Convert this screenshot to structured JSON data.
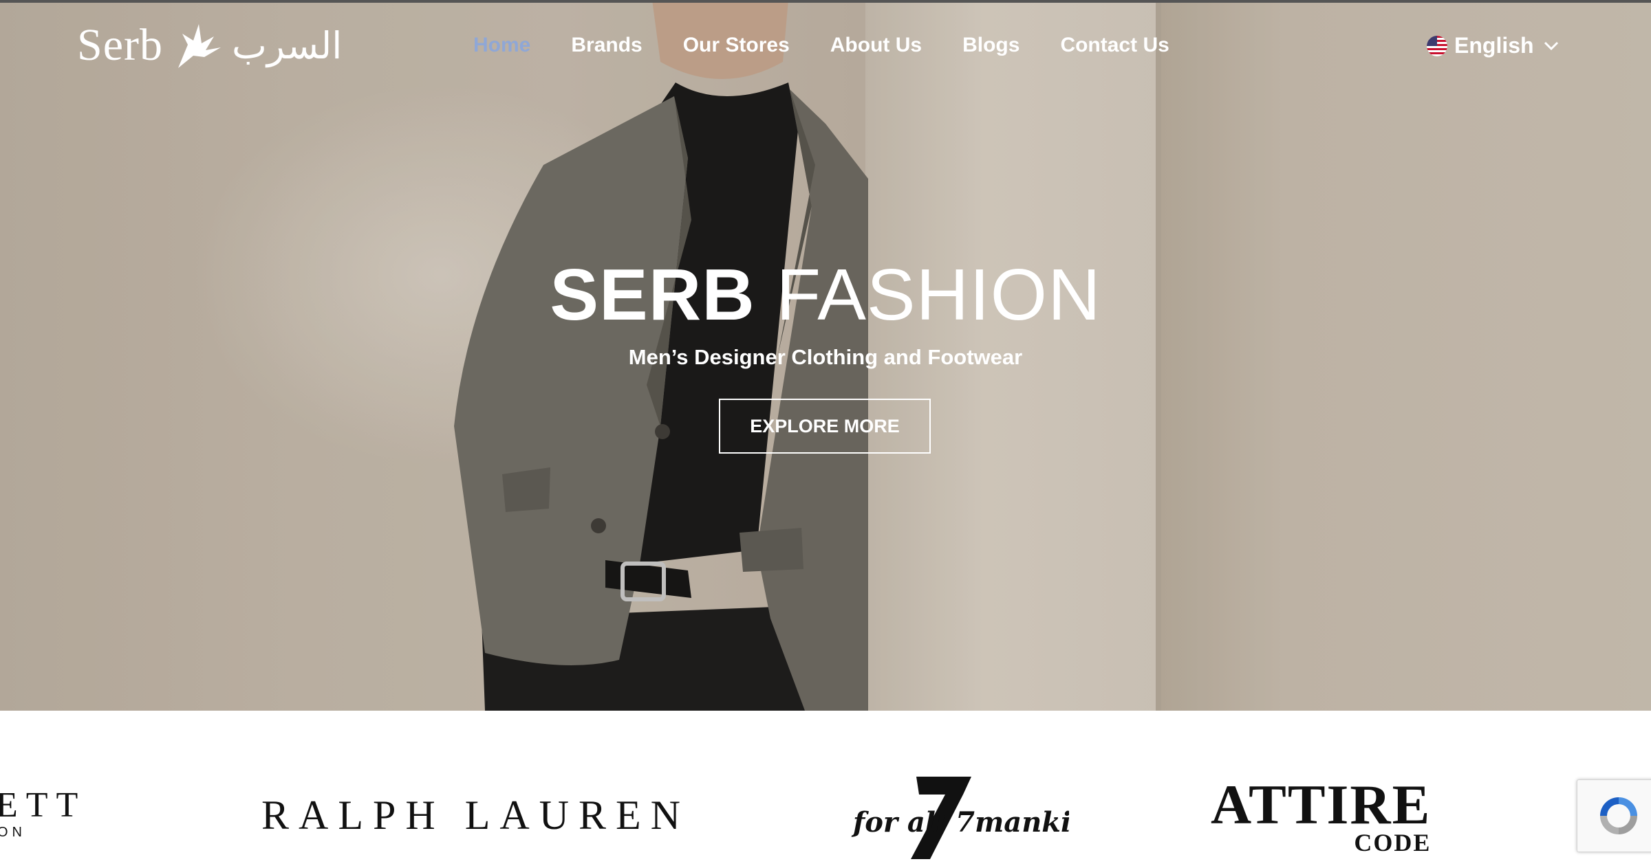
{
  "brand": {
    "logo_text": "Serb",
    "logo_arabic": "السرب"
  },
  "nav": {
    "items": [
      {
        "label": "Home",
        "active": true
      },
      {
        "label": "Brands"
      },
      {
        "label": "Our Stores"
      },
      {
        "label": "About Us"
      },
      {
        "label": "Blogs"
      },
      {
        "label": "Contact Us"
      }
    ]
  },
  "language": {
    "selected": "English",
    "flag_icon": "us-flag-icon"
  },
  "hero": {
    "title_bold": "SERB",
    "title_light": "FASHION",
    "subtitle": "Men’s Designer Clothing and Footwear",
    "cta_label": "EXPLORE MORE"
  },
  "brands_strip": {
    "partial_left": "ETT",
    "partial_left_sub": "ON",
    "ralph_lauren": "RALPH LAUREN",
    "seven_fam": "for all 7mankind",
    "attire_main": "ATTIRE",
    "attire_sub": "CODE"
  },
  "colors": {
    "nav_active": "#8fa7d6",
    "text_light": "#ffffff",
    "hero_bg": "#c6bbac"
  }
}
